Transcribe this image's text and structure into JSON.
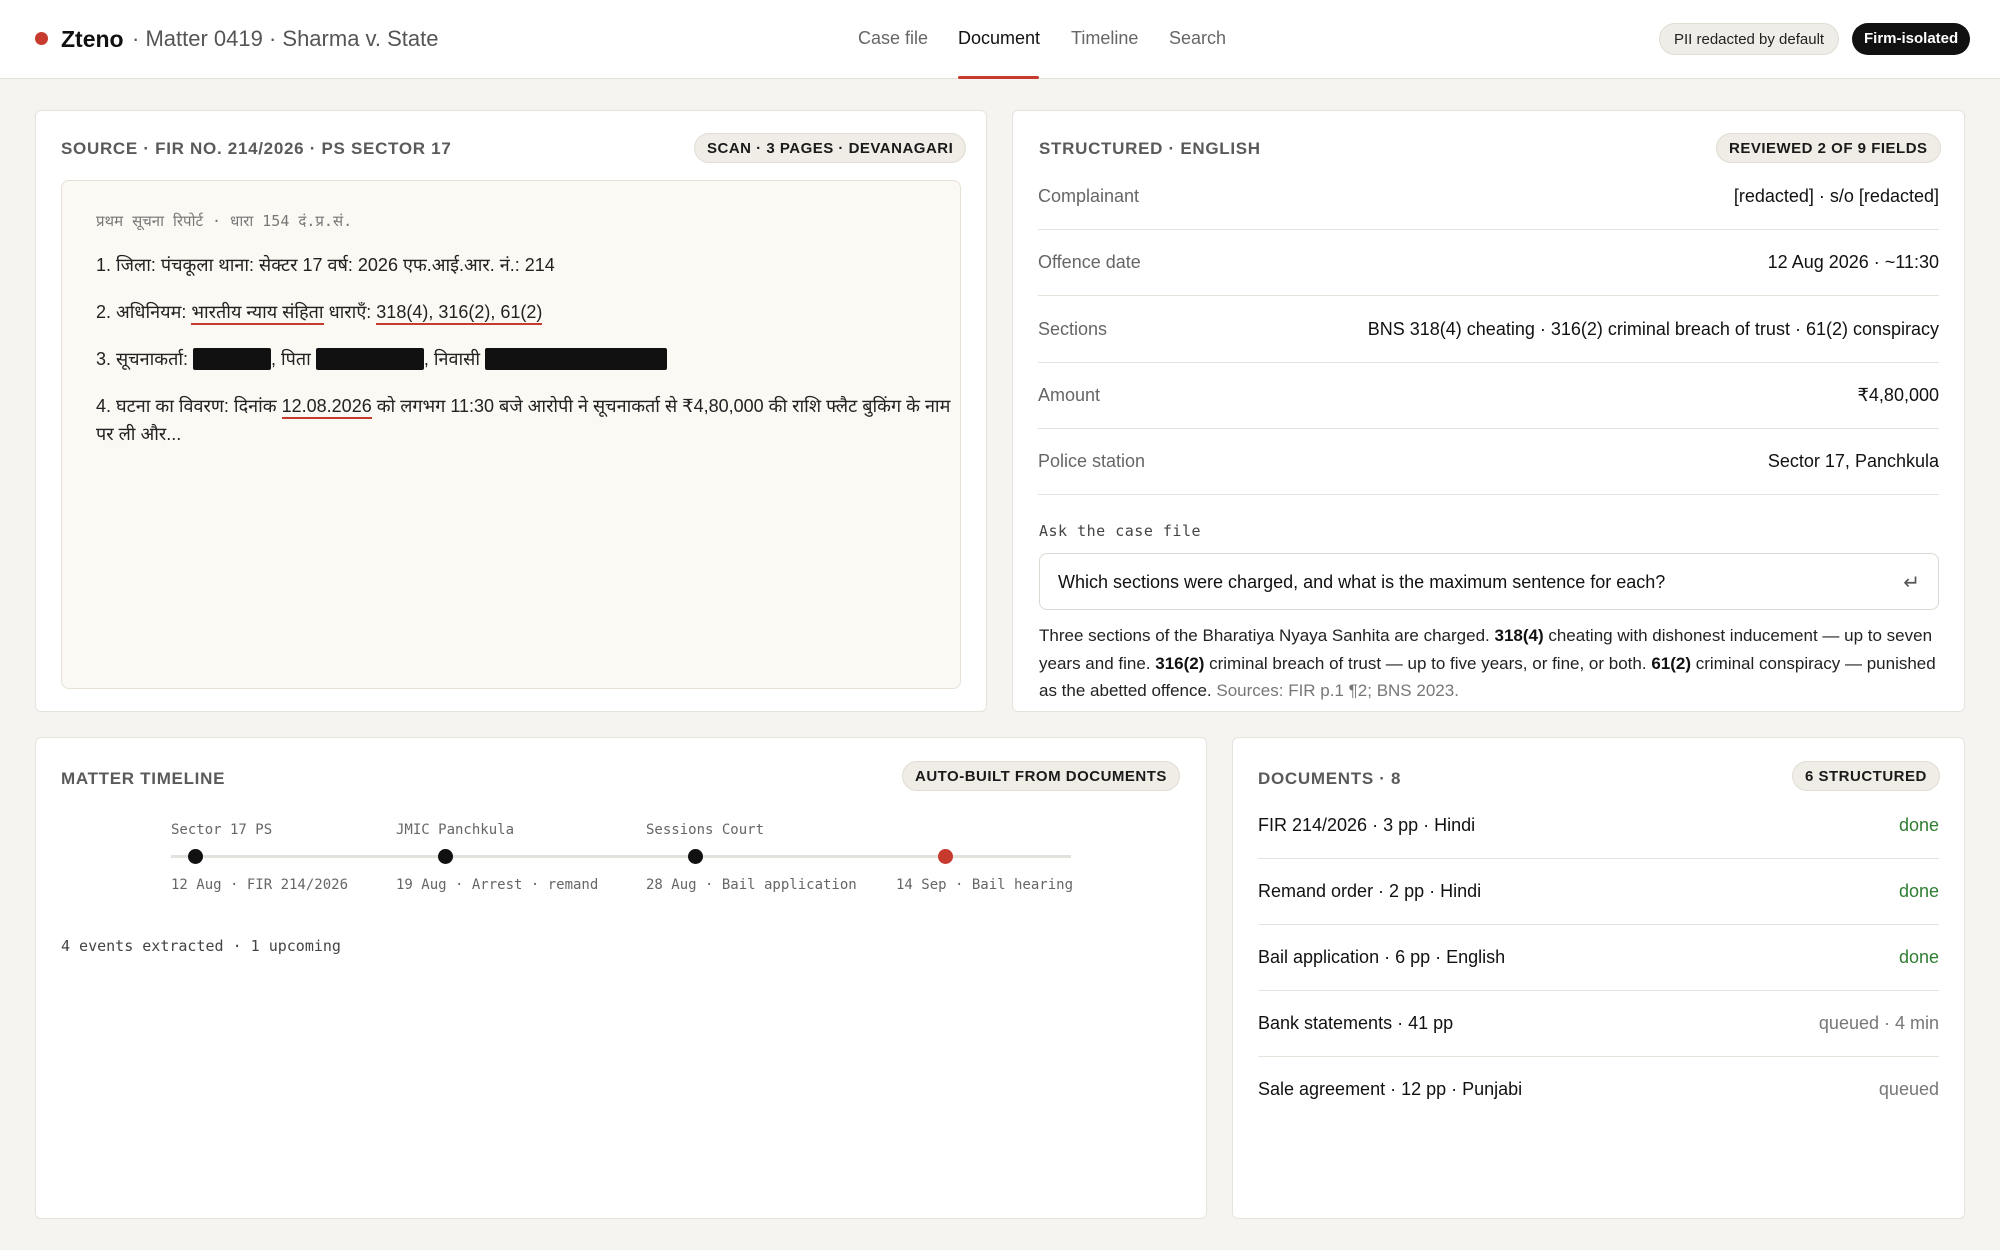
{
  "app": {
    "brand": "Zteno",
    "matter": "· Matter 0419 · Sharma v. State",
    "accent": "#c73a2e"
  },
  "nav": {
    "tabs": [
      {
        "label": "Case file",
        "active": false
      },
      {
        "label": "Document",
        "active": true
      },
      {
        "label": "Timeline",
        "active": false
      },
      {
        "label": "Search",
        "active": false
      }
    ]
  },
  "header_badges": {
    "pii": "PII redacted by default",
    "isolation": "Firm-isolated"
  },
  "source": {
    "title": "SOURCE · FIR NO. 214/2026 · PS SECTOR 17",
    "badge": "SCAN · 3 PAGES · DEVANAGARI",
    "heading": "प्रथम सूचना रिपोर्ट · धारा 154 दं.प्र.सं.",
    "line1": "1. जिला: पंचकूला   थाना: सेक्टर 17   वर्ष: 2026   एफ.आई.आर. नं.: 214",
    "line2_prefix": "2. अधिनियम: ",
    "line2_act": "भारतीय न्याय संहिता",
    "line2_mid": "   धाराएँ: ",
    "line2_sections": "318(4), 316(2), 61(2)",
    "line3_prefix": "3. सूचनाकर्ता: ",
    "line3_father": ", पिता ",
    "line3_resident": ", निवासी ",
    "line4_prefix": "4. घटना का विवरण: दिनांक ",
    "line4_date": "12.08.2026",
    "line4_rest": " को लगभग 11:30 बजे आरोपी ने सूचनाकर्ता से ₹4,80,000 की राशि फ्लैट बुकिंग के नाम",
    "line4_cont": "पर ली और..."
  },
  "structured": {
    "title": "STRUCTURED · ENGLISH",
    "badge": "REVIEWED 2 OF 9 FIELDS",
    "fields": [
      {
        "key": "Complainant",
        "value": "[redacted] · s/o [redacted]"
      },
      {
        "key": "Offence date",
        "value": "12 Aug 2026 · ~11:30"
      },
      {
        "key": "Sections",
        "value": "BNS 318(4) cheating · 316(2) criminal breach of trust · 61(2) conspiracy"
      },
      {
        "key": "Amount",
        "value": "₹4,80,000"
      },
      {
        "key": "Police station",
        "value": "Sector 17, Panchkula"
      }
    ],
    "ask_label": "Ask the case file",
    "question": "Which sections were charged, and what is the maximum sentence for each?",
    "enter_icon": "↵",
    "answer": {
      "p1": "Three sections of the Bharatiya Nyaya Sanhita are charged. ",
      "b1": "318(4)",
      "p2": " cheating with dishonest inducement — up to seven years and fine. ",
      "b2": "316(2)",
      "p3": " criminal breach of trust — up to five years, or fine, or both. ",
      "b3": "61(2)",
      "p4": " criminal conspiracy — punished as the abetted offence. ",
      "sources": "Sources: FIR p.1 ¶2; BNS 2023."
    }
  },
  "timeline": {
    "title": "MATTER TIMELINE",
    "badge": "AUTO-BUILT FROM DOCUMENTS",
    "events": [
      {
        "venue": "Sector 17 PS",
        "label": "12 Aug · FIR 214/2026",
        "upcoming": false
      },
      {
        "venue": "JMIC Panchkula",
        "label": "19 Aug · Arrest · remand",
        "upcoming": false
      },
      {
        "venue": "Sessions Court",
        "label": "28 Aug · Bail application",
        "upcoming": false
      },
      {
        "venue": "",
        "label": "14 Sep · Bail hearing",
        "upcoming": true
      }
    ],
    "summary": "4 events extracted · 1 upcoming"
  },
  "documents": {
    "title": "DOCUMENTS · 8",
    "badge": "6 STRUCTURED",
    "items": [
      {
        "name": "FIR 214/2026 · 3 pp · Hindi",
        "status": "done"
      },
      {
        "name": "Remand order · 2 pp · Hindi",
        "status": "done"
      },
      {
        "name": "Bail application · 6 pp · English",
        "status": "done"
      },
      {
        "name": "Bank statements · 41 pp",
        "status": "queued · 4 min"
      },
      {
        "name": "Sale agreement · 12 pp · Punjabi",
        "status": "queued"
      }
    ]
  }
}
